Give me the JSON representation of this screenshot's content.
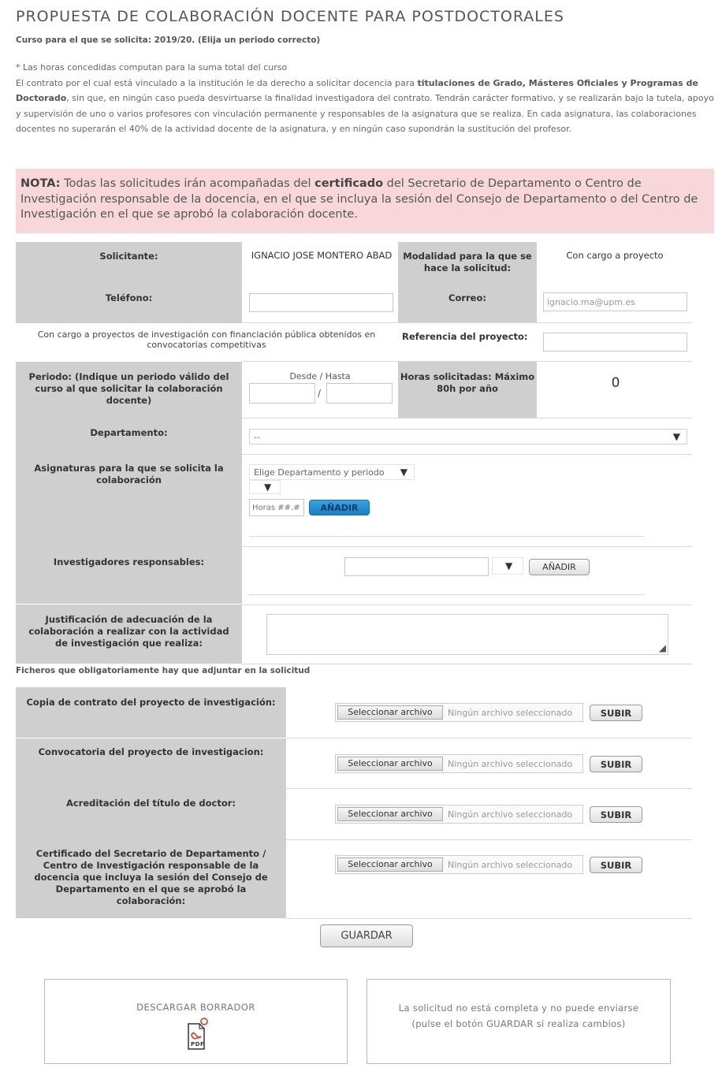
{
  "header": {
    "title": "PROPUESTA DE COLABORACIÓN DOCENTE PARA POSTDOCTORALES",
    "subtitle": "Curso para el que se solicita: 2019/20. (Elija un periodo correcto)"
  },
  "intro": {
    "line1": "* Las horas concedidas computan para la suma total del curso",
    "p_a": "El contrato por el cual está vinculado a la institución le da derecho a solicitar docencia para ",
    "p_b": "titulaciones de Grado, Másteres Oficiales y Programas de Doctorado",
    "p_c": ", sin que, en ningún caso pueda desvirtuarse la finalidad investigadora del contrato. Tendrán carácter formativo, y se realizarán bajo la tutela, apoyo y supervisión de uno o varios profesores con vinculación permanente y responsables de la asignatura que se realiza. En cada asignatura, las colaboraciones docentes no superarán el 40% de la actividad docente de la asignatura, y en ningún caso supondrán la sustitución del profesor."
  },
  "nota": {
    "label": "NOTA:",
    "text_a": " Todas las solicitudes irán acompañadas del ",
    "text_b": "certificado",
    "text_c": " del Secretario de Departamento o Centro de Investigación responsable de la docencia, en el que se incluya la sesión del Consejo de Departamento o del Centro de Investigación en el que se aprobó la colaboración docente."
  },
  "form": {
    "solicitante_label": "Solicitante:",
    "solicitante_value": "IGNACIO JOSE MONTERO ABAD",
    "modalidad_label": "Modalidad para la que se hace la solicitud:",
    "modalidad_value": "Con cargo a proyecto",
    "telefono_label": "Teléfono:",
    "telefono_value": "",
    "correo_label": "Correo:",
    "correo_value": "ignacio.ma@upm.es",
    "cargo_text": "Con cargo a proyectos de investigación con financiación pública obtenidos en convocatorias competitivas",
    "referencia_label": "Referencia del proyecto:",
    "referencia_value": "",
    "periodo_label": "Periodo: (Indique un periodo válido del curso al que solicitar la colaboración docente)",
    "desde_hasta": "Desde / Hasta",
    "slash": "/",
    "horas_label": "Horas solicitadas: Máximo 80h por año",
    "horas_value": "0",
    "departamento_label": "Departamento:",
    "departamento_value": "--",
    "asignaturas_label": "Asignaturas para la que se solicita la colaboración",
    "asignaturas_select": "Elige Departamento y periodo",
    "horas_placeholder": "Horas ##.#",
    "add_label": "AÑADIR",
    "investigadores_label": "Investigadores responsables:",
    "add_inv_label": "AÑADIR",
    "justificacion_label": "Justificación de adecuación de la colaboración a realizar con la actividad de investigación que realiza:"
  },
  "files": {
    "heading": "Ficheros que obligatoriamente hay que adjuntar en la solicitud",
    "select_label": "Seleccionar archivo",
    "none_label": "Ningún archivo seleccionado",
    "upload_label": "SUBIR",
    "items": [
      {
        "label": "Copia de contrato del proyecto de investigación:"
      },
      {
        "label": "Convocatoria del proyecto de investigacion:"
      },
      {
        "label": "Acreditación del título de doctor:"
      },
      {
        "label": "Certificado del Secretario de Departamento / Centro de Investigación responsable de la docencia que incluya la sesión del Consejo de Departamento en el que se aprobó la colaboración:"
      }
    ]
  },
  "actions": {
    "save_label": "GUARDAR",
    "download_label": "DESCARGAR BORRADOR",
    "pdf_text": "PDF",
    "status_text": "La solicitud no está completa y no puede enviarse (pulse el botón GUARDAR si realiza cambios)"
  },
  "colors": {
    "nota_bg": "#f8d7da",
    "label_bg": "#cfcfcf",
    "add_button": "#2a8fd0",
    "pdf_icon": "#d9341c"
  }
}
